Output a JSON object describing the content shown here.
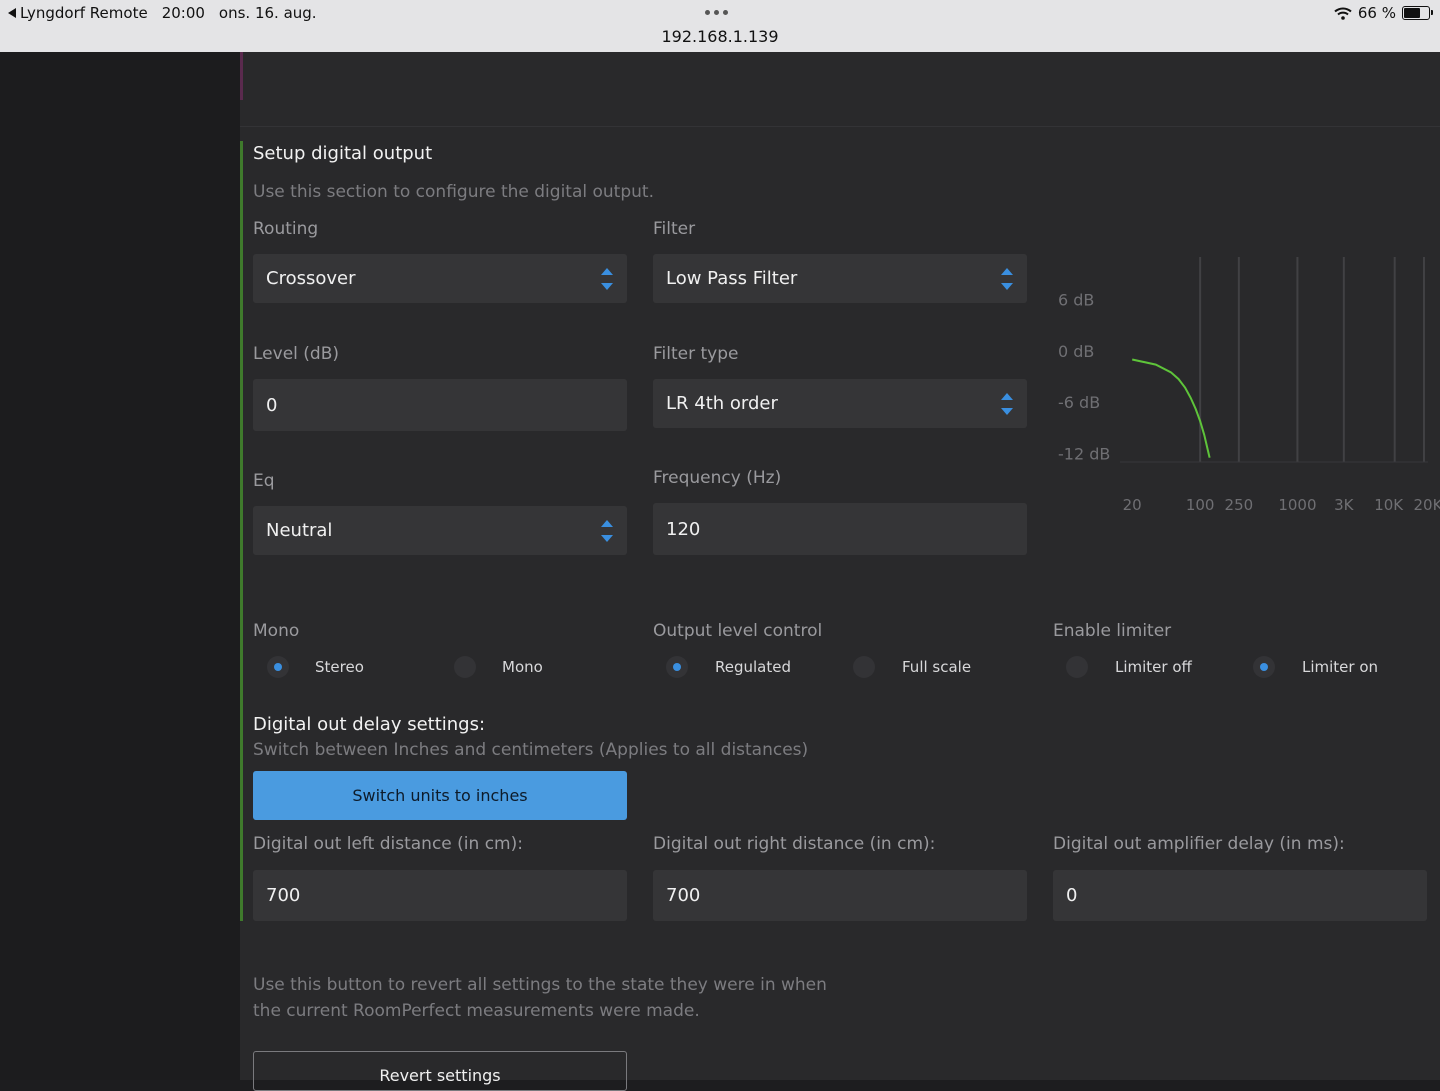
{
  "statusbar": {
    "back_app": "Lyngdorf Remote",
    "time": "20:00",
    "date": "ons. 16. aug.",
    "url": "192.168.1.139",
    "battery": "66 %",
    "battery_level": 0.66
  },
  "section": {
    "title": "Setup digital output",
    "description": "Use this section to configure the digital output."
  },
  "routing": {
    "label": "Routing",
    "value": "Crossover"
  },
  "filter": {
    "label": "Filter",
    "value": "Low Pass Filter"
  },
  "level": {
    "label": "Level (dB)",
    "value": "0"
  },
  "filter_type": {
    "label": "Filter type",
    "value": "LR 4th order"
  },
  "eq": {
    "label": "Eq",
    "value": "Neutral"
  },
  "frequency": {
    "label": "Frequency (Hz)",
    "value": "120"
  },
  "chart_data": {
    "type": "line",
    "y_tick_labels": [
      "6 dB",
      "0 dB",
      "-6 dB",
      "-12 dB"
    ],
    "y_ticks": [
      6,
      0,
      -6,
      -12
    ],
    "x_tick_labels": [
      "20",
      "100",
      "250",
      "1000",
      "3K",
      "10K",
      "20K"
    ],
    "x_ticks": [
      20,
      100,
      250,
      1000,
      3000,
      10000,
      20000
    ],
    "x_scale": "log",
    "grid": "vertical",
    "series": [
      {
        "color": "#5ec43a",
        "x": [
          20,
          35,
          50,
          60,
          70,
          80,
          90,
          100,
          110,
          120,
          125
        ],
        "y": [
          -1,
          -1.6,
          -2.5,
          -3.3,
          -4.3,
          -5.5,
          -6.8,
          -8.2,
          -9.8,
          -11.6,
          -12.5
        ]
      }
    ]
  },
  "mono": {
    "label": "Mono",
    "options": [
      {
        "label": "Stereo",
        "selected": true
      },
      {
        "label": "Mono",
        "selected": false
      }
    ]
  },
  "output_level": {
    "label": "Output level control",
    "options": [
      {
        "label": "Regulated",
        "selected": true
      },
      {
        "label": "Full scale",
        "selected": false
      }
    ]
  },
  "limiter": {
    "label": "Enable limiter",
    "options": [
      {
        "label": "Limiter off",
        "selected": false
      },
      {
        "label": "Limiter on",
        "selected": true
      }
    ]
  },
  "delay": {
    "title": "Digital out delay settings:",
    "description": "Switch between Inches and centimeters (Applies to all distances)",
    "switch_button": "Switch units to inches",
    "left": {
      "label": "Digital out left distance (in cm):",
      "value": "700"
    },
    "right": {
      "label": "Digital out right distance (in cm):",
      "value": "700"
    },
    "amp": {
      "label": "Digital out amplifier delay (in ms):",
      "value": "0"
    }
  },
  "revert": {
    "description_line1": "Use this button to revert all settings to the state they were in when",
    "description_line2": "the current RoomPerfect measurements were made.",
    "button": "Revert settings"
  },
  "colors": {
    "accent": "#4a9be0",
    "section_bar": "#3f7a2c",
    "curve": "#5ec43a"
  }
}
